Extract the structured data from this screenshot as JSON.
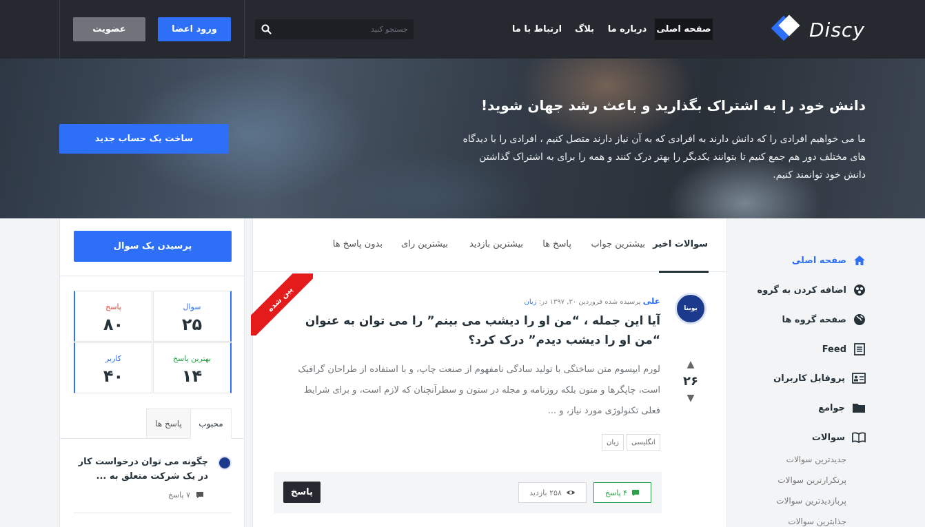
{
  "header": {
    "logo_text": "Discy",
    "nav": [
      "صفحه اصلی",
      "درباره ما",
      "بلاگ",
      "ارتباط با ما"
    ],
    "search_placeholder": "جستجو کنید",
    "login_label": "ورود اعضا",
    "signup_label": "عضویت"
  },
  "hero": {
    "title": "دانش خود را به اشتراک بگذارید و باعث رشد جهان شوید!",
    "description": "ما می خواهیم افرادی را که دانش دارند به افرادی که به آن نیاز دارند متصل کنیم ، افرادی را با دیدگاه های مختلف دور هم جمع کنیم تا بتوانند یکدیگر را بهتر درک کنند و همه را برای به اشتراک گذاشتن دانش خود توانمند کنیم.",
    "cta_label": "ساخت یک حساب جدید"
  },
  "sidebar_right": {
    "items": [
      {
        "label": "صفحه اصلی",
        "icon": "home-icon"
      },
      {
        "label": "اضافه کردن به گروه",
        "icon": "group-add-icon"
      },
      {
        "label": "صفحه گروه ها",
        "icon": "globe-icon"
      },
      {
        "label": "Feed",
        "icon": "feed-icon"
      },
      {
        "label": "پروفایل کاربران",
        "icon": "id-card-icon"
      },
      {
        "label": "جوامع",
        "icon": "folder-icon"
      },
      {
        "label": "سوالات",
        "icon": "book-icon"
      }
    ],
    "subitems": [
      "جدیدترین سوالات",
      "پرتکرارترین سوالات",
      "پربازدیدترین سوالات",
      "جذابترین سوالات"
    ]
  },
  "main": {
    "tabs": [
      "سوالات اخیر",
      "بیشترین جواب",
      "پاسخ ها",
      "بیشترین بازدید",
      "بیشترین رای",
      "بدون پاسخ ها"
    ],
    "question": {
      "pinned_label": "پین شده",
      "avatar_text": "یوبنا",
      "author": "علی",
      "asked_text": "پرسیده شده فروردین ۳۰, ۱۳۹۷",
      "in_label": "در:",
      "category": "زبان",
      "title": "آیا این جمله ، “من او را دیشب می بینم” را می توان به عنوان “من او را دیشب دیدم” درک کرد؟",
      "excerpt": "لورم ایپسوم متن ساختگی با تولید سادگی نامفهوم از صنعت چاپ، و با استفاده از طراحان گرافیک است، چاپگرها و متون بلکه روزنامه و مجله در ستون و سطرآنچنان که لازم است، و برای شرایط فعلی تکنولوژی مورد نیاز، و ...",
      "votes": "۲۶",
      "tags": [
        "انگلیسی",
        "زبان"
      ],
      "answers_label": "۴ پاسخ",
      "views_label": "۲۵۸ بازدید",
      "answer_button": "پاسخ"
    }
  },
  "sidebar_left": {
    "ask_button": "پرسیدن یک سوال",
    "stats": [
      {
        "label": "سوال",
        "value": "۲۵",
        "color": "#2d6ff7"
      },
      {
        "label": "پاسخ",
        "value": "۸۰",
        "color": "#e0463c"
      },
      {
        "label": "بهترین پاسخ",
        "value": "۱۴",
        "color": "#2ca24a"
      },
      {
        "label": "کاربر",
        "value": "۴۰",
        "color": "#2d6ff7"
      }
    ],
    "tabs": [
      "محبوب",
      "پاسخ ها"
    ],
    "popular": [
      {
        "title": "چگونه می توان درخواست کار در یک شرکت متعلق به ...",
        "answers": "۷ پاسخ"
      }
    ]
  },
  "colors": {
    "accent": "#2d6ff7",
    "header_bg": "#272930",
    "pinned": "#e41b1b",
    "success": "#2ca24a"
  }
}
